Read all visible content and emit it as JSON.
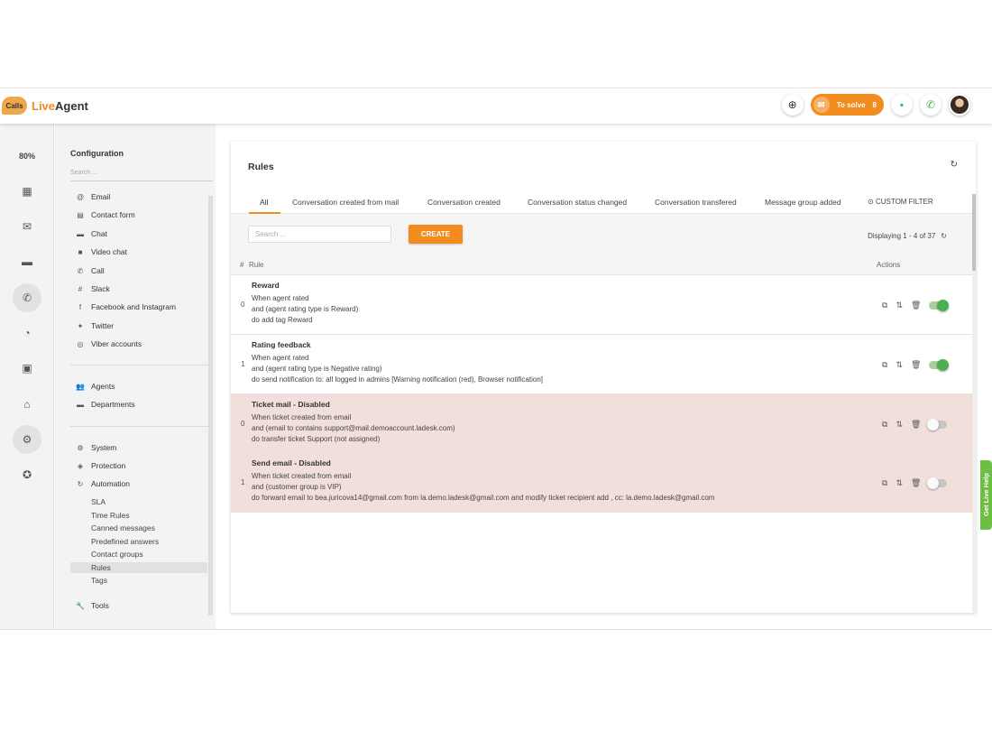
{
  "header": {
    "logo_bubble": "Calls",
    "logo_part1": "Live",
    "logo_part2": "Agent",
    "to_solve_label": "To solve",
    "to_solve_count": "8",
    "brand_color": "#f28c1f"
  },
  "rail": {
    "zoom": "80%",
    "icons": [
      "dashboard-icon",
      "email-icon",
      "chat-icon",
      "call-icon",
      "reports-icon",
      "contacts-icon",
      "knowledgebase-icon",
      "settings-icon",
      "plugins-icon"
    ]
  },
  "config": {
    "title": "Configuration",
    "search_placeholder": "Search ...",
    "channels": [
      {
        "label": "Email",
        "icon": "at-icon"
      },
      {
        "label": "Contact form",
        "icon": "form-icon"
      },
      {
        "label": "Chat",
        "icon": "chat-icon"
      },
      {
        "label": "Video chat",
        "icon": "video-icon"
      },
      {
        "label": "Call",
        "icon": "phone-icon"
      },
      {
        "label": "Slack",
        "icon": "slack-icon"
      },
      {
        "label": "Facebook and Instagram",
        "icon": "facebook-icon"
      },
      {
        "label": "Twitter",
        "icon": "twitter-icon"
      },
      {
        "label": "Viber accounts",
        "icon": "viber-icon"
      }
    ],
    "people": [
      {
        "label": "Agents",
        "icon": "agents-icon"
      },
      {
        "label": "Departments",
        "icon": "folder-icon"
      }
    ],
    "system": [
      {
        "label": "System",
        "icon": "gear-icon"
      },
      {
        "label": "Protection",
        "icon": "shield-icon"
      },
      {
        "label": "Automation",
        "icon": "automation-icon"
      }
    ],
    "automation_sub": [
      "SLA",
      "Time Rules",
      "Canned messages",
      "Predefined answers",
      "Contact groups",
      "Rules",
      "Tags"
    ],
    "tools": {
      "label": "Tools",
      "icon": "wrench-icon"
    }
  },
  "main": {
    "title": "Rules",
    "tabs": [
      "All",
      "Conversation created from mail",
      "Conversation created",
      "Conversation status changed",
      "Conversation transfered",
      "Message group added"
    ],
    "custom_filter": "CUSTOM FILTER",
    "search_placeholder": "Search ...",
    "create_label": "CREATE",
    "displaying": "Displaying 1 - 4 of 37",
    "col_num": "#",
    "col_rule": "Rule",
    "col_actions": "Actions",
    "rules": [
      {
        "num": "0",
        "name": "Reward",
        "lines": [
          "When agent rated",
          "and (agent rating type is Reward)",
          "do add tag Reward"
        ],
        "enabled": true
      },
      {
        "num": "1",
        "name": "Rating feedback",
        "lines": [
          "When agent rated",
          "and (agent rating type is Negative rating)",
          "do send notification to: all logged in admins [Warning notification (red), Browser notification]"
        ],
        "enabled": true
      },
      {
        "num": "0",
        "name": "Ticket mail - Disabled",
        "lines": [
          "When ticket created from email",
          "and (email to contains support@mail.demoaccount.ladesk.com)",
          "do transfer ticket Support (not assigned)"
        ],
        "enabled": false
      },
      {
        "num": "1",
        "name": "Send email - Disabled",
        "lines": [
          "When ticket created from email",
          "and (customer group is VIP)",
          "do forward email to bea.juricova14@gmail.com from la.demo.ladesk@gmail.com and modify ticket recipient add , cc: la.demo.ladesk@gmail.com"
        ],
        "enabled": false
      }
    ]
  },
  "live_help": "Get Live Help"
}
